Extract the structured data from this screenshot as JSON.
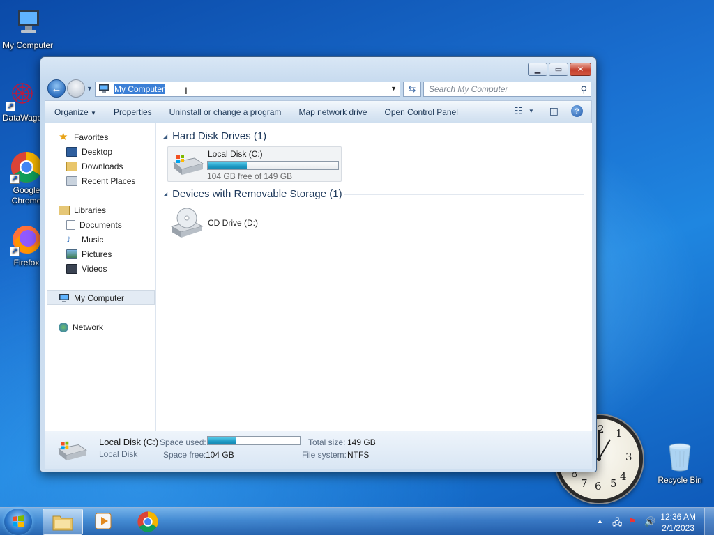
{
  "desktop": {
    "icons": [
      {
        "label": "My Computer",
        "icon": "computer-icon"
      },
      {
        "label": "DataWago",
        "icon": "datawagon-icon"
      },
      {
        "label": "Google Chrome",
        "line1": "Google",
        "line2": "Chrome",
        "icon": "chrome-icon"
      },
      {
        "label": "Firefox",
        "icon": "firefox-icon"
      },
      {
        "label": "Recycle Bin",
        "icon": "recycle-bin-icon"
      }
    ],
    "clock_gadget": {
      "numbers": [
        "1",
        "2",
        "3",
        "4",
        "5",
        "6",
        "7",
        "8"
      ]
    }
  },
  "window": {
    "address": {
      "value": "My Computer",
      "icon": "computer-icon"
    },
    "search": {
      "placeholder": "Search My Computer"
    },
    "toolbar": {
      "organize": "Organize",
      "properties": "Properties",
      "uninstall": "Uninstall or change a program",
      "map_drive": "Map network drive",
      "control_panel": "Open Control Panel"
    },
    "nav": {
      "favorites": "Favorites",
      "desktop": "Desktop",
      "downloads": "Downloads",
      "recent": "Recent Places",
      "libraries": "Libraries",
      "documents": "Documents",
      "music": "Music",
      "pictures": "Pictures",
      "videos": "Videos",
      "my_computer": "My Computer",
      "network": "Network"
    },
    "groups": {
      "hdd": "Hard Disk Drives (1)",
      "removable": "Devices with Removable Storage (1)"
    },
    "drive_c": {
      "name": "Local Disk (C:)",
      "free_text": "104 GB free of 149 GB",
      "used_fraction": 0.3
    },
    "drive_d": {
      "name": "CD Drive (D:)"
    },
    "details": {
      "name": "Local Disk (C:)",
      "type": "Local Disk",
      "space_used_label": "Space used:",
      "space_free_label": "Space free:",
      "space_free": "104 GB",
      "total_size_label": "Total size:",
      "total_size": "149 GB",
      "file_system_label": "File system:",
      "file_system": "NTFS"
    }
  },
  "taskbar": {
    "apps": [
      "windows-explorer",
      "media-player",
      "google-chrome"
    ],
    "time": "12:36 AM",
    "date": "2/1/2023"
  },
  "colors": {
    "accent": "#3b7fd6",
    "group_header": "#1e395b",
    "drive_bar": "#1e9ac4"
  }
}
